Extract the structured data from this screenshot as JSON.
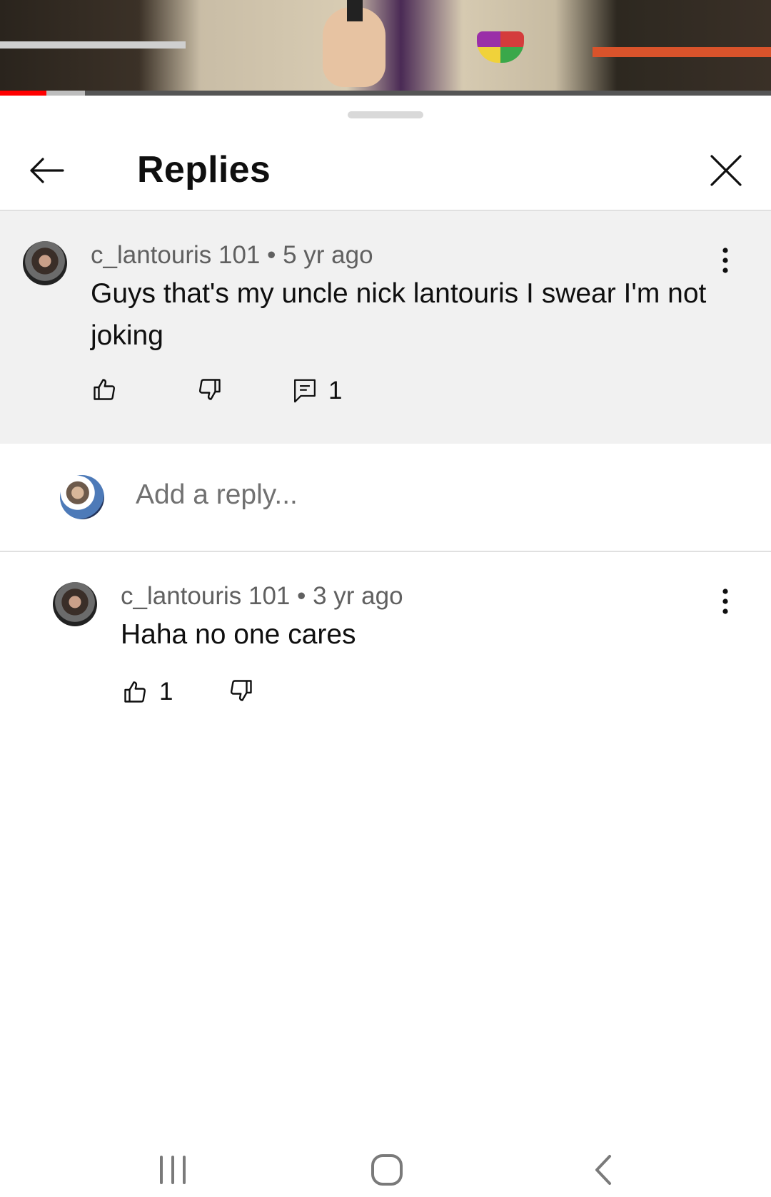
{
  "sheet": {
    "title": "Replies"
  },
  "player": {
    "progress_fraction": 0.06,
    "buffer_fraction": 0.11
  },
  "parent_comment": {
    "author": "c_lantouris 101",
    "age": "5 yr ago",
    "text": "Guys that's my uncle nick lantouris I swear I'm not joking",
    "reply_count": "1"
  },
  "composer": {
    "placeholder": "Add a reply..."
  },
  "replies": [
    {
      "author": "c_lantouris 101",
      "age": "3 yr ago",
      "text": "Haha no one cares",
      "like_count": "1"
    }
  ],
  "colors": {
    "progress": "#ff0000",
    "highlight_bg": "#f1f1f1"
  }
}
